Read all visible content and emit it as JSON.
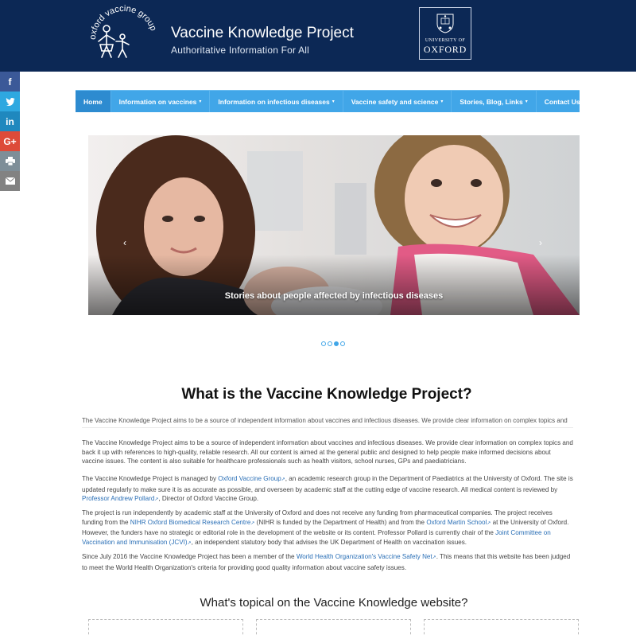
{
  "header": {
    "logo_text": "oxford vaccine group",
    "title": "Vaccine Knowledge Project",
    "tagline": "Authoritative Information For All",
    "oxford_univ": "UNIVERSITY OF",
    "oxford_name": "OXFORD",
    "bg_color": "#0c2855"
  },
  "social": {
    "facebook": "f",
    "twitter": "t",
    "linkedin": "in",
    "googleplus": "G+",
    "print": "print-icon",
    "email": "email-icon"
  },
  "nav": {
    "items": [
      {
        "label": "Home",
        "dropdown": false,
        "active": true
      },
      {
        "label": "Information on vaccines",
        "dropdown": true
      },
      {
        "label": "Information on infectious diseases",
        "dropdown": true
      },
      {
        "label": "Vaccine safety and science",
        "dropdown": true
      },
      {
        "label": "Stories, Blog, Links",
        "dropdown": true
      },
      {
        "label": "Contact Us",
        "dropdown": false
      }
    ],
    "caret": "▾",
    "color": "#41a6e8"
  },
  "carousel": {
    "caption": "Stories about people affected by infectious diseases",
    "prev": "‹",
    "next": "›",
    "slides": 4,
    "active_slide": 3
  },
  "main": {
    "heading": "What is the Vaccine Knowledge Project?",
    "clipped_line": "The Vaccine Knowledge Project aims to be a source of independent information about vaccines and infectious diseases. We provide clear information on complex topics and",
    "p1": "The Vaccine Knowledge Project aims to be a source of independent information about vaccines and infectious diseases. We provide clear information on complex topics and back it up with references to high-quality, reliable research. All our content is aimed at the general public and designed to help people make informed decisions about vaccine issues. The content is also suitable for healthcare professionals such as health visitors, school nurses, GPs and paediatricians.",
    "p2_a": "The Vaccine Knowledge Project is managed by ",
    "p2_link1": "Oxford Vaccine Group",
    "p2_b": ", an academic research group in the Department of Paediatrics at the University of Oxford. The site is updated regularly to make sure it is as accurate as possible, and overseen by academic staff at the cutting edge of vaccine research. All medical content is reviewed by ",
    "p2_link2": "Professor Andrew Pollard",
    "p2_c": ", Director of Oxford Vaccine Group.",
    "p3_a": "The project is run independently by academic staff at the University of Oxford and does not receive any funding from pharmaceutical companies. The project receives funding from the ",
    "p3_link1": "NIHR Oxford Biomedical Research Centre",
    "p3_b": " (NIHR is funded by the Department of Health) and from the ",
    "p3_link2": "Oxford Martin School",
    "p3_c": " at the University of Oxford. However, the funders have no strategic or editorial role in the development of the website or its content. Professor Pollard is currently chair of the ",
    "p3_link3": "Joint Committee on Vaccination and Immunisation (JCVI)",
    "p3_d": ", an independent statutory body that advises the UK Department of Health on vaccination issues.",
    "p4_a": "Since July 2016 the Vaccine Knowledge Project has been a member of the ",
    "p4_link1": "World Health Organization's Vaccine Safety Net",
    "p4_b": ". This means that this website has been judged to meet the World Health Organization's criteria for providing good quality information about vaccine safety issues.",
    "topical_heading": "What's topical on the Vaccine Knowledge website?",
    "ext_icon": "↗"
  }
}
